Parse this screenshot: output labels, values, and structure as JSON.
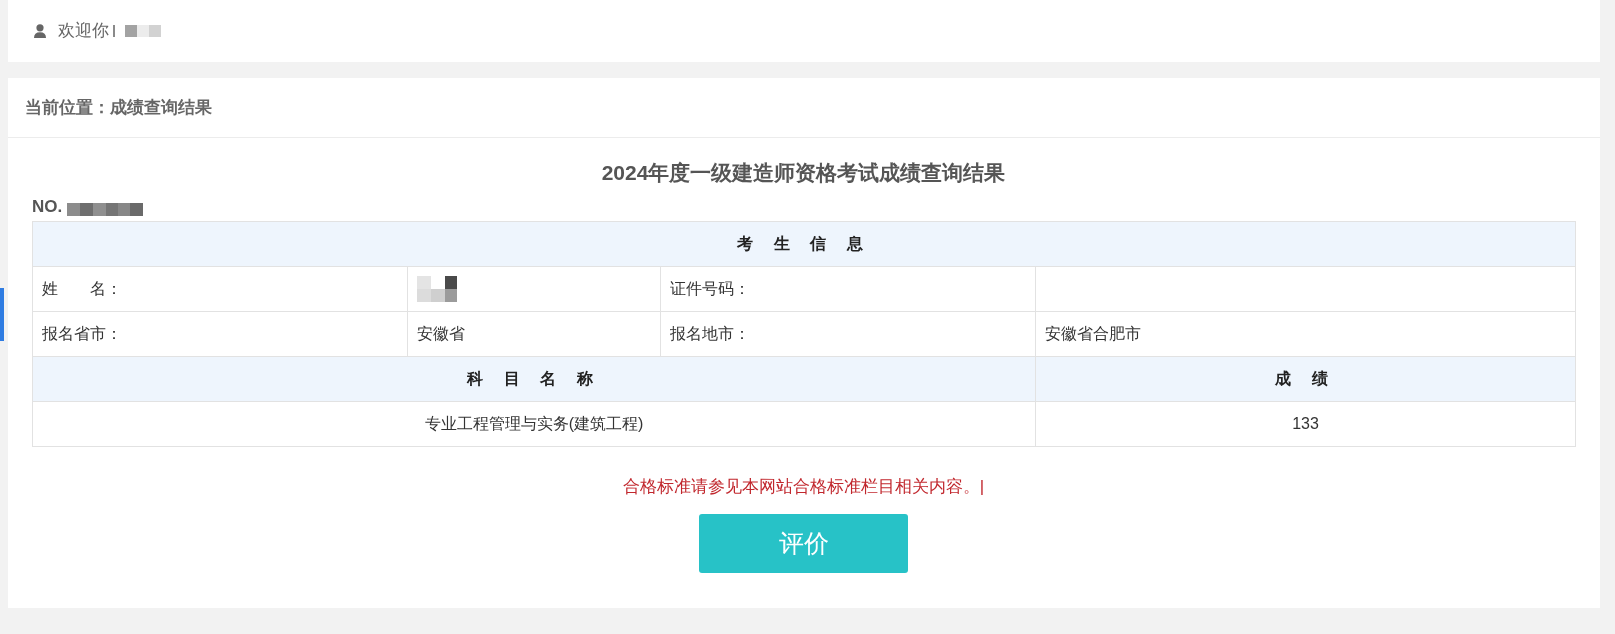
{
  "header": {
    "greeting": "欢迎你",
    "name_redacted": true
  },
  "breadcrumb": "当前位置：成绩查询结果",
  "result": {
    "title": "2024年度一级建造师资格考试成绩查询结果",
    "number_label": "NO.",
    "number_redacted": true
  },
  "info_table": {
    "heading": "考 生 信 息",
    "rows": [
      {
        "fields": [
          {
            "label": "姓　　名：",
            "value_redacted": true
          },
          {
            "label": "证件号码："
          }
        ]
      },
      {
        "fields": [
          {
            "label": "报名省市：",
            "value": "安徽省"
          },
          {
            "label": "报名地市：",
            "value": "安徽省合肥市"
          }
        ]
      }
    ]
  },
  "score_table": {
    "columns": [
      "科 目 名 称",
      "成 绩"
    ],
    "rows": [
      [
        "专业工程管理与实务(建筑工程)",
        "133"
      ]
    ]
  },
  "notice": "合格标准请参见本网站合格标准栏目相关内容。|",
  "evaluate_button": "评价"
}
